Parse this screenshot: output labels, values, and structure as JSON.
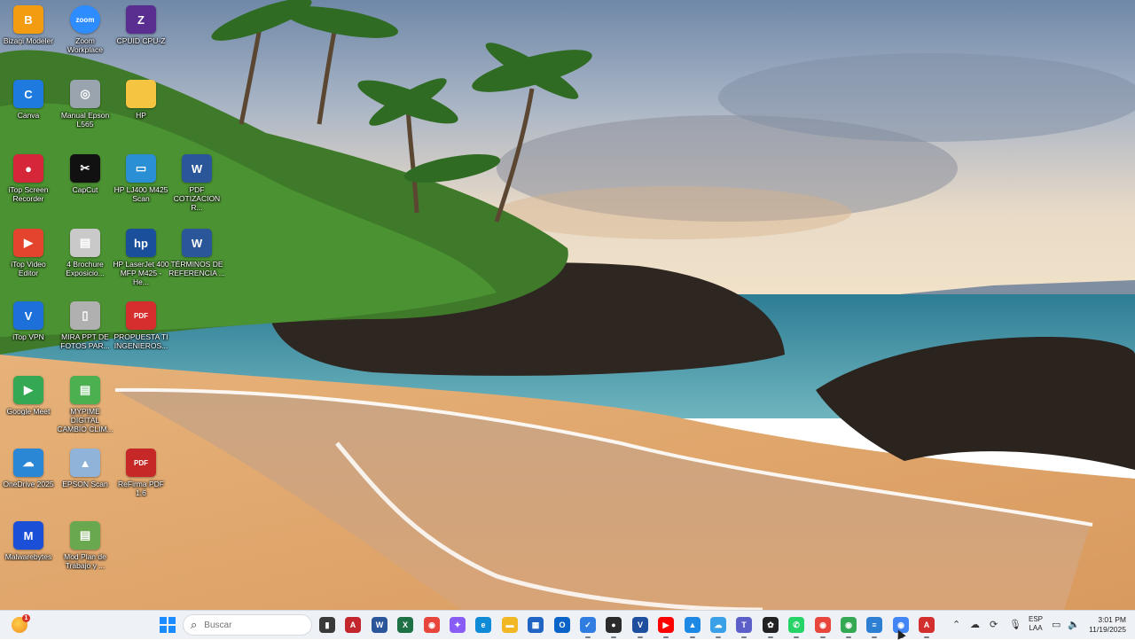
{
  "desktop_icons": [
    {
      "label": "Bizagi Modeler",
      "icon": "bizagi-icon",
      "color": "#f39c12",
      "glyph": "B"
    },
    {
      "label": "Zoom Workplace",
      "icon": "zoom-icon",
      "color": "#2d8cff",
      "glyph": "zoom"
    },
    {
      "label": "CPUID CPU-Z",
      "icon": "cpuz-icon",
      "color": "#5a2d91",
      "glyph": "Z"
    },
    {
      "label": "Canva",
      "icon": "canva-icon",
      "color": "#1f7ae0",
      "glyph": "C"
    },
    {
      "label": "Manual Epson L565",
      "icon": "disc-icon",
      "color": "#9aa4ae",
      "glyph": "◎"
    },
    {
      "label": "HP",
      "icon": "folder-icon",
      "color": "#f5c542",
      "glyph": ""
    },
    {
      "label": "iTop Screen Recorder",
      "icon": "itop-recorder-icon",
      "color": "#d6263a",
      "glyph": "●"
    },
    {
      "label": "CapCut",
      "icon": "capcut-icon",
      "color": "#111111",
      "glyph": "✂"
    },
    {
      "label": "HP LJ400 M425 Scan",
      "icon": "scanner-icon",
      "color": "#2b8fd6",
      "glyph": "▭"
    },
    {
      "label": "PDF COTIZACION R...",
      "icon": "word-doc-icon",
      "color": "#2b579a",
      "glyph": "W"
    },
    {
      "label": "iTop Video Editor",
      "icon": "itop-video-icon",
      "color": "#e4432d",
      "glyph": "▶"
    },
    {
      "label": "4 Brochure Exposicio...",
      "icon": "image-file-icon",
      "color": "#c9c9c9",
      "glyph": "▤"
    },
    {
      "label": "HP LaserJet 400 MFP M425 - He...",
      "icon": "hp-printer-icon",
      "color": "#1a4f9c",
      "glyph": "hp"
    },
    {
      "label": "TÉRMINOS DE REFERENCIA ...",
      "icon": "word-doc-icon",
      "color": "#2b579a",
      "glyph": "W"
    },
    {
      "label": "iTop VPN",
      "icon": "itop-vpn-icon",
      "color": "#1d6fd9",
      "glyph": "V"
    },
    {
      "label": "MIRA PPT DE FOTOS PAR...",
      "icon": "phone-image-icon",
      "color": "#b0b0b0",
      "glyph": "▯"
    },
    {
      "label": "PROPUESTA TI INGENIEROS...",
      "icon": "pdf-icon",
      "color": "#d62e2e",
      "glyph": "PDF"
    },
    {
      "label": "Google Meet",
      "icon": "google-meet-icon",
      "color": "#34a853",
      "glyph": "▶"
    },
    {
      "label": "MYPIME DIGITAL CAMBIO CLIM...",
      "icon": "image-file-icon",
      "color": "#4caf50",
      "glyph": "▤"
    },
    {
      "label": "OneDrive 2025",
      "icon": "onedrive-folder-icon",
      "color": "#2a87d6",
      "glyph": "☁"
    },
    {
      "label": "EPSON Scan",
      "icon": "epson-scan-icon",
      "color": "#8fb3d9",
      "glyph": "▲"
    },
    {
      "label": "ReFirma PDF 1.6",
      "icon": "refirma-pdf-icon",
      "color": "#c62828",
      "glyph": "PDF"
    },
    {
      "label": "Malwarebytes",
      "icon": "malwarebytes-icon",
      "color": "#1b4fd8",
      "glyph": "M"
    },
    {
      "label": "Mod Plan de Trabajo y ...",
      "icon": "image-file-icon",
      "color": "#6aa84f",
      "glyph": "▤"
    }
  ],
  "taskbar": {
    "weather_badge": "1",
    "search_placeholder": "Buscar",
    "apps": [
      {
        "name": "task-view-icon",
        "color": "#3a3a3a",
        "glyph": "▮"
      },
      {
        "name": "acrobat-icon",
        "color": "#c4262e",
        "glyph": "A"
      },
      {
        "name": "word-icon",
        "color": "#2b579a",
        "glyph": "W"
      },
      {
        "name": "excel-icon",
        "color": "#1e7145",
        "glyph": "X"
      },
      {
        "name": "chrome-icon",
        "color": "#e8453c",
        "glyph": "◉"
      },
      {
        "name": "copilot-icon",
        "color": "#8a5cf6",
        "glyph": "✦"
      },
      {
        "name": "edge-icon",
        "color": "#0f8ad6",
        "glyph": "e"
      },
      {
        "name": "file-explorer-icon",
        "color": "#f2b824",
        "glyph": "▬"
      },
      {
        "name": "microsoft-store-icon",
        "color": "#2164c4",
        "glyph": "▦"
      },
      {
        "name": "outlook-icon",
        "color": "#0a64c8",
        "glyph": "O"
      },
      {
        "name": "todo-icon",
        "color": "#2f7de1",
        "glyph": "✓"
      },
      {
        "name": "itop-recorder-icon",
        "color": "#2b2b2b",
        "glyph": "●"
      },
      {
        "name": "itop-vpn-icon",
        "color": "#1d4f9e",
        "glyph": "V"
      },
      {
        "name": "youtube-icon",
        "color": "#ff0000",
        "glyph": "▶"
      },
      {
        "name": "photos-icon",
        "color": "#1e88e5",
        "glyph": "▲"
      },
      {
        "name": "onedrive-folder-icon",
        "color": "#3aa0e8",
        "glyph": "☁"
      },
      {
        "name": "teams-icon",
        "color": "#5b5fc7",
        "glyph": "T"
      },
      {
        "name": "chatgpt-icon",
        "color": "#222222",
        "glyph": "✿"
      },
      {
        "name": "whatsapp-icon",
        "color": "#25d366",
        "glyph": "✆"
      },
      {
        "name": "chrome-profile-icon",
        "color": "#e8453c",
        "glyph": "◉"
      },
      {
        "name": "chrome-profile-2-icon",
        "color": "#34a853",
        "glyph": "◉"
      },
      {
        "name": "notepad-icon",
        "color": "#2d7fd3",
        "glyph": "≡"
      },
      {
        "name": "chrome-profile-3-icon",
        "color": "#4285f4",
        "glyph": "◉"
      },
      {
        "name": "acrobat-reader-icon",
        "color": "#d32f2f",
        "glyph": "A"
      }
    ],
    "lang_top": "ESP",
    "lang_bottom": "LAA",
    "time": "3:01 PM",
    "date": "11/19/2025"
  }
}
